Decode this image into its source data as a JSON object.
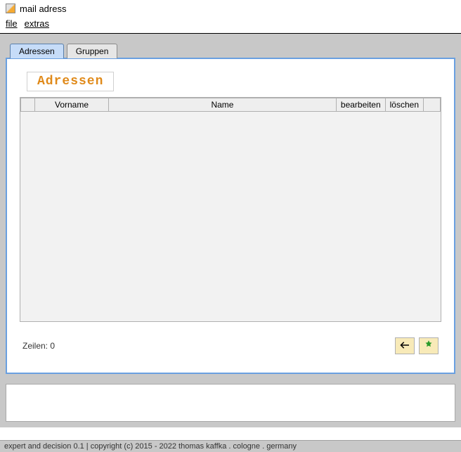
{
  "window": {
    "title": "mail adress"
  },
  "menu": {
    "file": "file",
    "extras": "extras"
  },
  "tabs": {
    "adressen": "Adressen",
    "gruppen": "Gruppen"
  },
  "section": {
    "heading": "Adressen"
  },
  "table": {
    "columns": {
      "vorname": "Vorname",
      "name": "Name",
      "bearbeiten": "bearbeiten",
      "loeschen": "löschen"
    },
    "rows": []
  },
  "footer": {
    "row_label": "Zeilen:",
    "row_count": "0"
  },
  "status": "expert and decision 0.1 | copyright (c) 2015 - 2022 thomas kaffka . cologne . germany"
}
